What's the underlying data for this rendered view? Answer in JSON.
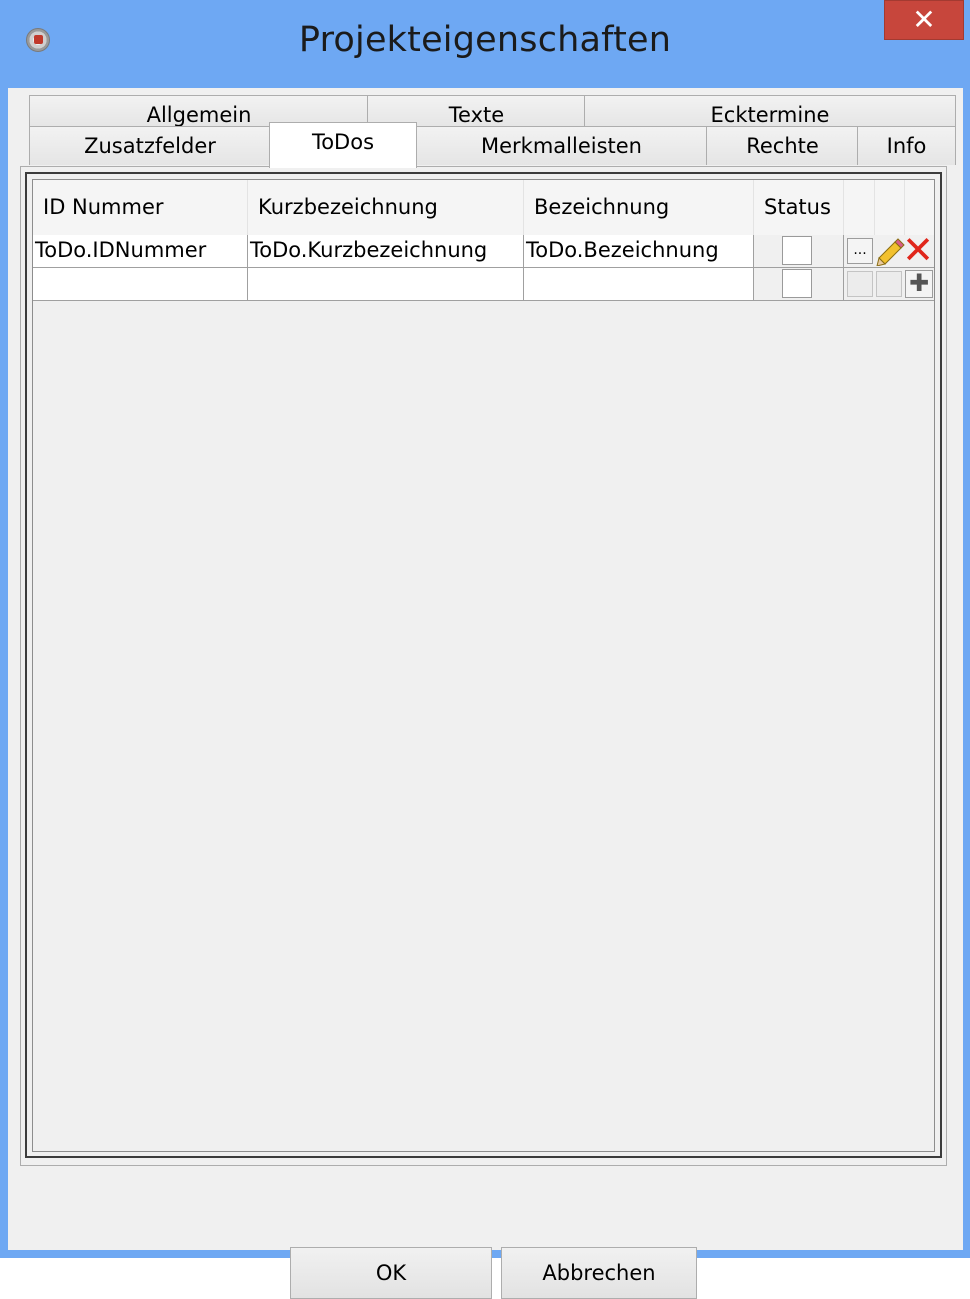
{
  "window": {
    "title": "Projekteigenschaften",
    "close_glyph": "✕"
  },
  "tabs": {
    "row1": [
      "Allgemein",
      "Texte",
      "Ecktermine"
    ],
    "row2": [
      "Zusatzfelder",
      "ToDos",
      "Merkmalleisten",
      "Rechte",
      "Info"
    ],
    "active": "ToDos"
  },
  "grid": {
    "columns": [
      "ID Nummer",
      "Kurzbezeichnung",
      "Bezeichnung",
      "Status"
    ],
    "rows": [
      {
        "id": "ToDo.IDNummer",
        "kurz": "ToDo.Kurzbezeichnung",
        "bez": "ToDo.Bezeichnung",
        "status_checked": false,
        "actions": [
          "ellipsis-icon",
          "pencil-icon",
          "delete-icon"
        ],
        "ellipsis_glyph": "...",
        "delete_glyph": "✕"
      },
      {
        "id": "",
        "kurz": "",
        "bez": "",
        "status_checked": false,
        "actions": [
          "disabled",
          "disabled",
          "plus-icon"
        ],
        "plus_glyph": "✚"
      }
    ]
  },
  "buttons": {
    "ok": "OK",
    "cancel": "Abbrechen"
  },
  "colors": {
    "titlebar": "#6ea8f3",
    "close": "#c7463c",
    "delete": "#e0261b"
  }
}
